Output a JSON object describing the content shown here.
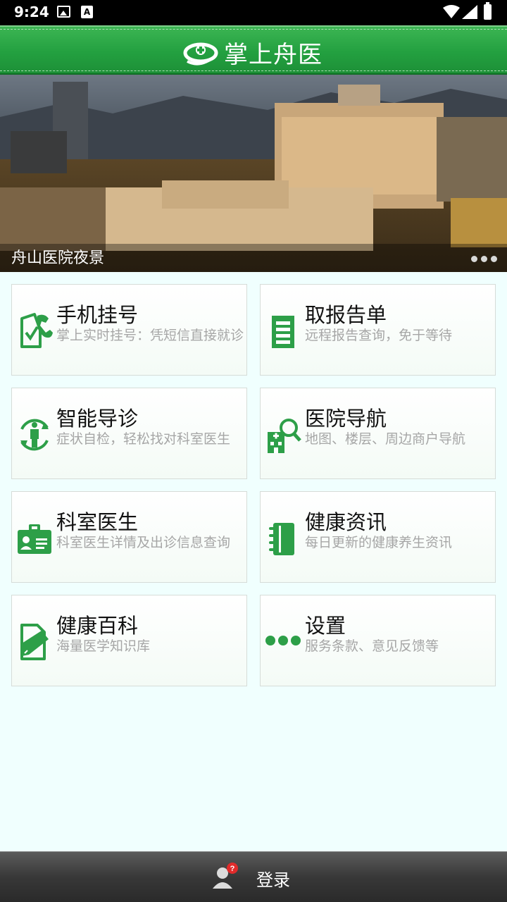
{
  "status_bar": {
    "time": "9:24",
    "icons": [
      "image-icon",
      "font-icon",
      "wifi-icon",
      "signal-icon",
      "battery-icon"
    ]
  },
  "header": {
    "title": "掌上舟医",
    "logo": "zhoushan-hospital-logo",
    "color": "#23a040"
  },
  "banner": {
    "caption": "舟山医院夜景",
    "slides_indicator": 3
  },
  "menu": [
    {
      "title": "手机挂号",
      "desc": "掌上实时挂号：凭短信直接就诊",
      "icon": "phone-register-icon"
    },
    {
      "title": "取报告单",
      "desc": "远程报告查询，免于等待",
      "icon": "report-icon"
    },
    {
      "title": "智能导诊",
      "desc": "症状自检，轻松找对科室医生",
      "icon": "body-guide-icon"
    },
    {
      "title": "医院导航",
      "desc": "地图、楼层、周边商户导航",
      "icon": "hospital-search-icon"
    },
    {
      "title": "科室医生",
      "desc": "科室医生详情及出诊信息查询",
      "icon": "doctor-badge-icon"
    },
    {
      "title": "健康资讯",
      "desc": "每日更新的健康养生资讯",
      "icon": "notebook-icon"
    },
    {
      "title": "健康百科",
      "desc": "海量医学知识库",
      "icon": "edit-document-icon"
    },
    {
      "title": "设置",
      "desc": "服务条款、意见反馈等",
      "icon": "more-dots-icon"
    }
  ],
  "bottom_bar": {
    "login_label": "登录",
    "badge": "?"
  },
  "accent_color": "#2d9f48"
}
